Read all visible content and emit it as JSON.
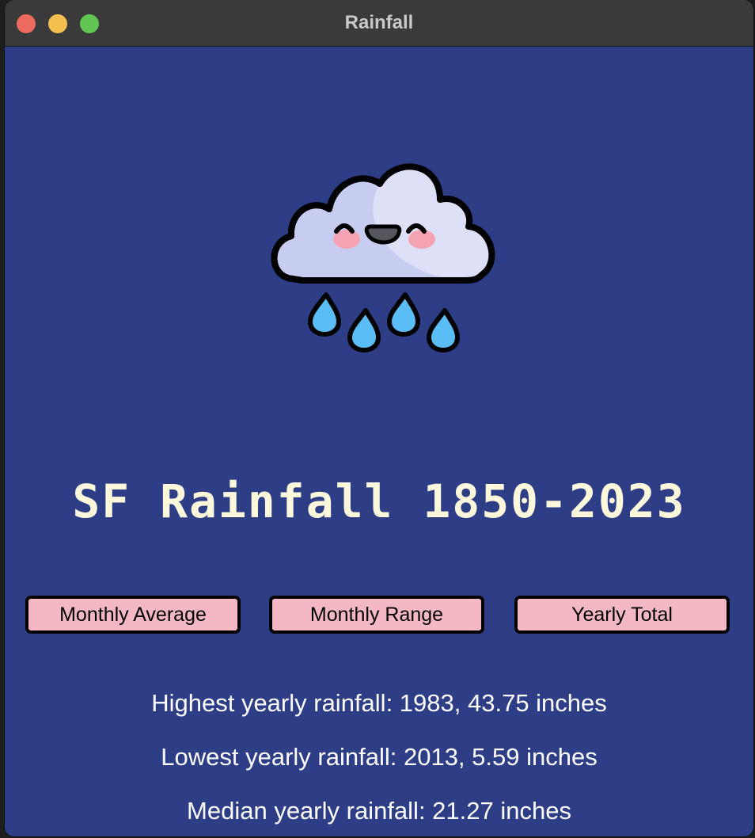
{
  "window": {
    "title": "Rainfall"
  },
  "logo": {
    "icon": "rain-cloud-icon"
  },
  "main": {
    "heading": "SF Rainfall 1850-2023"
  },
  "buttons": {
    "monthly_average": "Monthly Average",
    "monthly_range": "Monthly Range",
    "yearly_total": "Yearly Total"
  },
  "stats": {
    "highest": "Highest yearly rainfall: 1983, 43.75 inches",
    "lowest": "Lowest yearly rainfall: 2013, 5.59 inches",
    "median": "Median yearly rainfall: 21.27 inches"
  },
  "colors": {
    "background": "#2d3e87",
    "heading": "#fdf8dc",
    "button_fill": "#f4b8c4",
    "button_border": "#000000",
    "stat_text": "#ffffff"
  }
}
